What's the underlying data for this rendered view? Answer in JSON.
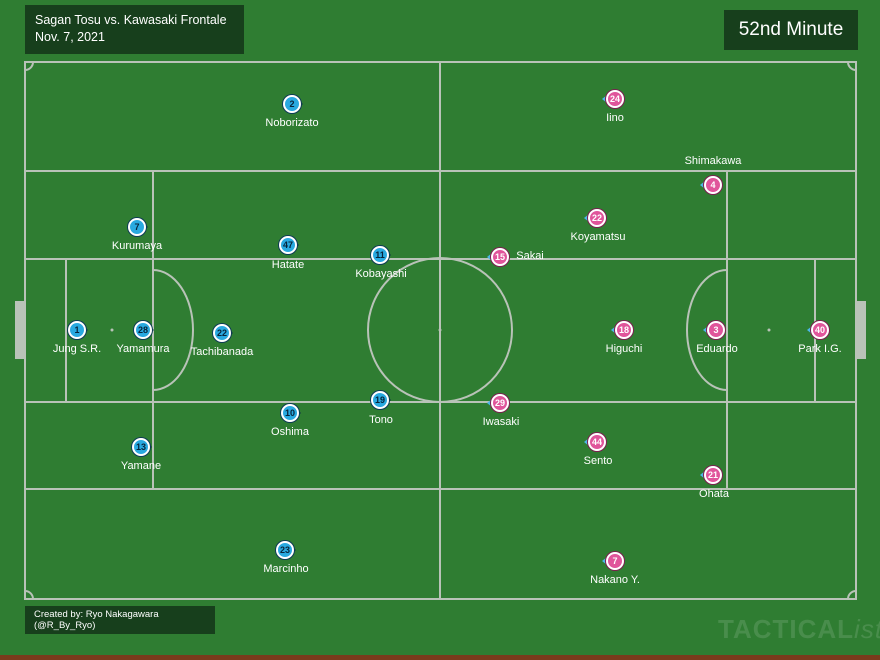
{
  "match": {
    "title": "Sagan Tosu vs. Kawasaki Frontale",
    "date": "Nov. 7, 2021",
    "minute": "52nd Minute"
  },
  "credit": "Created by: Ryo Nakagawara (@R_By_Ryo)",
  "watermark": {
    "main": "TACTICAL",
    "italic": "ista"
  },
  "colors": {
    "pitch": "#2f7d32",
    "lines": "#b9c3b8",
    "box": "#173f1c",
    "home": "#29a9e0",
    "away": "#e0559b"
  },
  "home_players": [
    {
      "number": "2",
      "name": "Noborizato"
    },
    {
      "number": "7",
      "name": "Kurumaya"
    },
    {
      "number": "47",
      "name": "Hatate"
    },
    {
      "number": "11",
      "name": "Kobayashi"
    },
    {
      "number": "1",
      "name": "Jung S.R."
    },
    {
      "number": "28",
      "name": "Yamamura"
    },
    {
      "number": "22",
      "name": "Tachibanada"
    },
    {
      "number": "10",
      "name": "Oshima"
    },
    {
      "number": "19",
      "name": "Tono"
    },
    {
      "number": "13",
      "name": "Yamane"
    },
    {
      "number": "23",
      "name": "Marcinho"
    }
  ],
  "away_players": [
    {
      "number": "24",
      "name": "Iino"
    },
    {
      "number": "4",
      "name": "Shimakawa"
    },
    {
      "number": "22",
      "name": "Koyamatsu"
    },
    {
      "number": "15",
      "name": "Sakai"
    },
    {
      "number": "18",
      "name": "Higuchi"
    },
    {
      "number": "3",
      "name": "Eduardo"
    },
    {
      "number": "40",
      "name": "Park I.G."
    },
    {
      "number": "29",
      "name": "Iwasaki"
    },
    {
      "number": "44",
      "name": "Sento"
    },
    {
      "number": "21",
      "name": "Ohata"
    },
    {
      "number": "7",
      "name": "Nakano Y."
    }
  ]
}
